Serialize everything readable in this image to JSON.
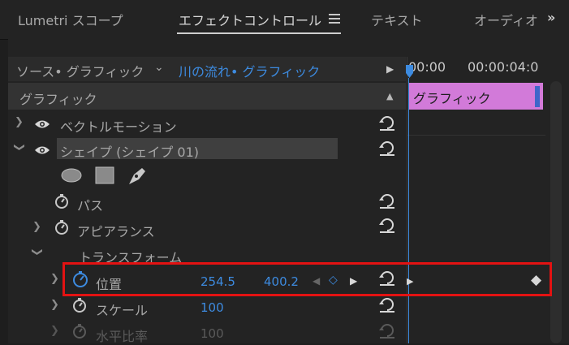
{
  "tabs": [
    {
      "label": "Lumetri スコープ"
    },
    {
      "label": "エフェクトコントロール"
    },
    {
      "label": "テキスト"
    },
    {
      "label": "オーディオ"
    }
  ],
  "more_tabs": "»",
  "source": {
    "label": "ソース• グラフィック",
    "clip": "川の流れ• グラフィック"
  },
  "section": "グラフィック",
  "rows": {
    "vector_motion": "ベクトルモーション",
    "shape": "シェイプ (シェイプ 01)",
    "path": "パス",
    "appearance": "アピアランス",
    "transform": "トランスフォーム",
    "position": {
      "label": "位置",
      "x": "254.5",
      "y": "400.2"
    },
    "scale": {
      "label": "スケール",
      "value": "100"
    },
    "h_scale": {
      "label": "水平比率",
      "value": "100"
    }
  },
  "timeline": {
    "t0": "00:00",
    "t1": "00:00:04:0",
    "clip_label": "グラフィック"
  },
  "colors": {
    "accent": "#3d8be0",
    "clip": "#d27ad9",
    "highlight": "#e31212"
  }
}
